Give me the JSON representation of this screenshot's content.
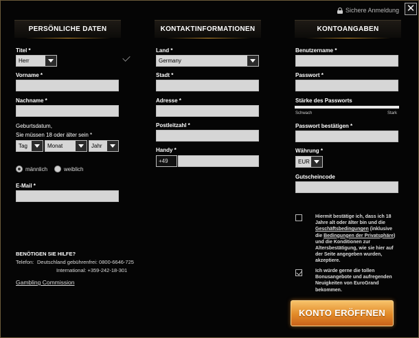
{
  "header": {
    "secure_login": "Sichere Anmeldung",
    "close_symbol": "✕"
  },
  "columns": {
    "personal": "PERSÖNLICHE DATEN",
    "contact": "KONTAKTINFORMATIONEN",
    "account": "KONTOANGABEN"
  },
  "personal": {
    "title_label": "Titel *",
    "title_value": "Herr",
    "first_name_label": "Vorname *",
    "last_name_label": "Nachname *",
    "birth_label": "Geburtsdatum,",
    "birth_sub": "Sie müssen 18 oder älter sein *",
    "day_value": "Tag",
    "month_value": "Monat",
    "year_value": "Jahr",
    "male": "männlich",
    "female": "weiblich",
    "email_label": "E-Mail *"
  },
  "contact": {
    "country_label": "Land *",
    "country_value": "Germany",
    "city_label": "Stadt *",
    "address_label": "Adresse *",
    "zip_label": "Postleitzahl *",
    "mobile_label": "Handy *",
    "mobile_prefix": "+49"
  },
  "account": {
    "username_label": "Benutzername *",
    "password_label": "Passwort *",
    "strength_label": "Stärke des Passworts",
    "weak": "Schwach",
    "strong": "Stark",
    "confirm_label": "Passwort bestätigen *",
    "currency_label": "Währung *",
    "currency_value": "EUR",
    "voucher_label": "Gutscheincode"
  },
  "terms": {
    "line1": "Hiermit bestätige ich, dass ich 18",
    "line2": "Jahre alt oder älter bin und die",
    "link1": "Geschäftsbedingungen",
    "line3_rest": " (inklusive",
    "line4_pre": "die ",
    "link2": "Bedingungen der Privatsphäre",
    "line4_post": ")",
    "line5": "und die Konditionen zur",
    "line6": "Altersbestätigung, wie sie hier auf",
    "line7": "der Seite angegeben wurden,",
    "line8": "akzeptiere.",
    "promo1": "Ich würde gerne die tollen",
    "promo2": "Bonusangebote und aufregenden",
    "promo3": "Neuigkeiten von EuroGrand",
    "promo4": "bekommen."
  },
  "help": {
    "title": "BENÖTIGEN SIE HILFE?",
    "phone_label": "Telefon:",
    "phone_de": "Deutschland gebührenfrei: 0800-6646-725",
    "phone_intl": "International: +359-242-18-301",
    "gambling": "Gambling Commission"
  },
  "submit_label": "KONTO ERÖFFNEN",
  "accent_color": "#e28a28"
}
